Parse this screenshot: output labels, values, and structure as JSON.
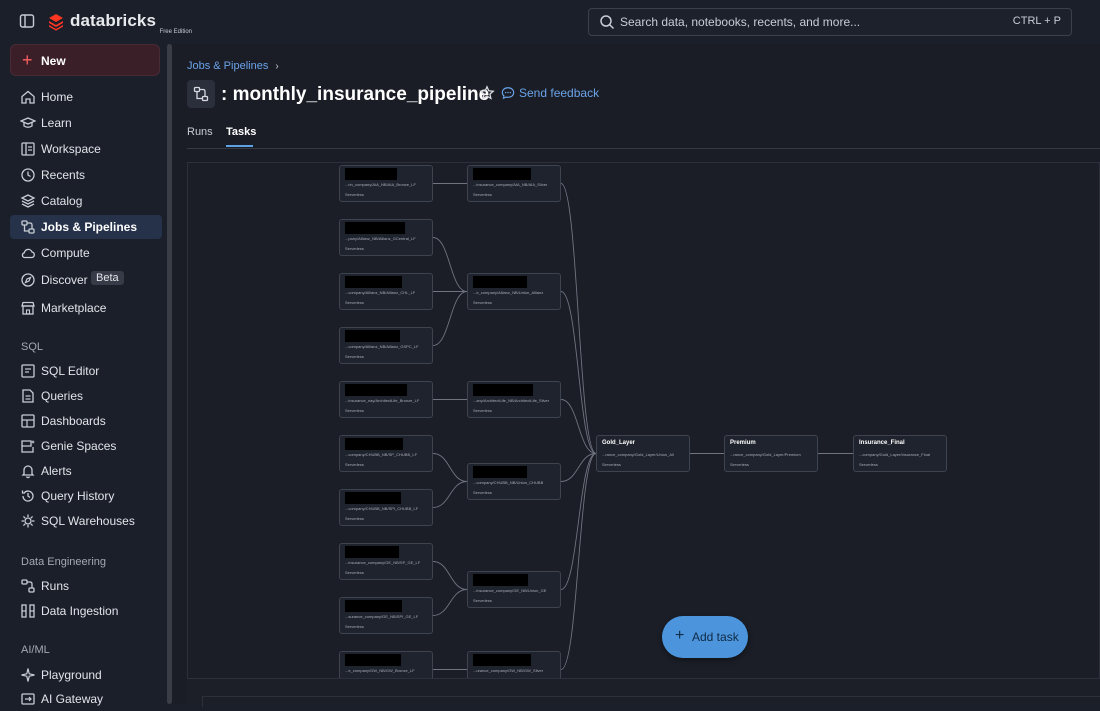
{
  "brand": {
    "name": "databricks",
    "edition": "Free Edition",
    "accent": "#ff3621"
  },
  "search": {
    "placeholder": "Search data, notebooks, recents, and more...",
    "shortcut": "CTRL + P"
  },
  "sidebar": {
    "new_label": "New",
    "items": [
      {
        "label": "Home",
        "icon": "home-icon"
      },
      {
        "label": "Learn",
        "icon": "learn-icon"
      },
      {
        "label": "Workspace",
        "icon": "workspace-icon"
      },
      {
        "label": "Recents",
        "icon": "clock-icon"
      },
      {
        "label": "Catalog",
        "icon": "catalog-icon"
      },
      {
        "label": "Jobs & Pipelines",
        "icon": "jobs-icon",
        "active": true
      },
      {
        "label": "Compute",
        "icon": "cloud-icon"
      },
      {
        "label": "Discover",
        "icon": "compass-icon",
        "badge": "Beta"
      },
      {
        "label": "Marketplace",
        "icon": "marketplace-icon"
      }
    ],
    "sql_section": "SQL",
    "sql_items": [
      {
        "label": "SQL Editor",
        "icon": "sql-editor-icon"
      },
      {
        "label": "Queries",
        "icon": "queries-icon"
      },
      {
        "label": "Dashboards",
        "icon": "dashboard-icon"
      },
      {
        "label": "Genie Spaces",
        "icon": "genie-icon"
      },
      {
        "label": "Alerts",
        "icon": "bell-icon"
      },
      {
        "label": "Query History",
        "icon": "history-icon"
      },
      {
        "label": "SQL Warehouses",
        "icon": "warehouse-icon"
      }
    ],
    "de_section": "Data Engineering",
    "de_items": [
      {
        "label": "Runs",
        "icon": "runs-icon"
      },
      {
        "label": "Data Ingestion",
        "icon": "ingestion-icon"
      }
    ],
    "ai_section": "AI/ML",
    "ai_items": [
      {
        "label": "Playground",
        "icon": "playground-icon"
      },
      {
        "label": "AI Gateway",
        "icon": "gateway-icon"
      }
    ]
  },
  "main": {
    "breadcrumb": "Jobs & Pipelines",
    "title": ": monthly_insurance_pipeline",
    "feedback_label": "Send feedback",
    "tabs": [
      {
        "label": "Runs"
      },
      {
        "label": "Tasks",
        "active": true
      }
    ],
    "add_task_label": "Add task"
  },
  "graph": {
    "compute_label": "Serverless",
    "tasks": [
      {
        "path": "...rin_company/AIA_NB/AIA_Bronze_LF"
      },
      {
        "path": "...pany/Allianz_NB/Allianz_GCentral_LF"
      },
      {
        "path": "...company/Allianz_NB/Allianz_CHL_LF"
      },
      {
        "path": "...company/Allianz_NB/Allianz_GSPC_LF"
      },
      {
        "path": "...insurance_nay/ArchitectLife_Bronze_LF"
      },
      {
        "path": "...company/CHUBB_NB/SP_CHUBB_LF"
      },
      {
        "path": "...company/CHUBB_NB/SPI_CHUBB_LF"
      },
      {
        "path": "...insurance_company/GE_NB/SP_GE_LF"
      },
      {
        "path": "...surance_company/GE_NB/SPI_GE_LF"
      },
      {
        "path": "...e_company/GW_NB/GW_Bronze_LF"
      },
      {
        "path": "...insurance_company/AIA_NB/AIA_Silver"
      },
      {
        "path": "...e_company/Allianz_NB/Union_Allianz"
      },
      {
        "path": "...any/ArchitectLife_NB/ArchitectLife_Silver"
      },
      {
        "path": "...company/CHUBB_NB/Union_CHUBB"
      },
      {
        "path": "...insurance_company/GE_NB/Union_GE"
      },
      {
        "path": "...urance_company/GW_NB/GW_Silver"
      },
      {
        "title": "Gold_Layer",
        "path": "...rance_company/Gold_Layer/Union_All"
      },
      {
        "title": "Premium",
        "path": "...rance_company/Gold_Layer/Premium"
      },
      {
        "title": "Insurance_Final",
        "path": "...company/Gold_Layer/Insurance_Final"
      }
    ]
  }
}
